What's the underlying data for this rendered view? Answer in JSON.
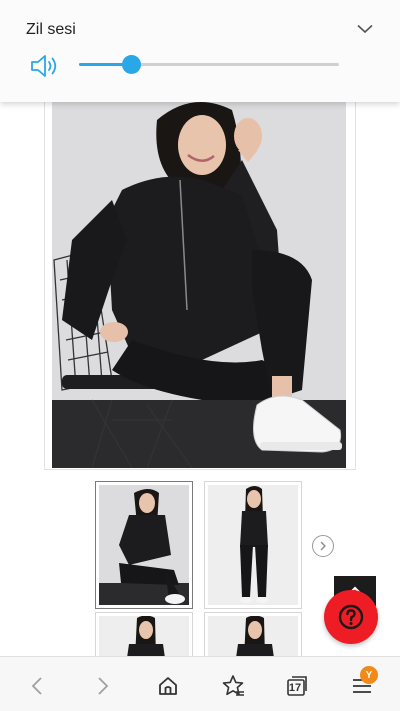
{
  "volume_panel": {
    "title": "Zil sesi",
    "level": 0.2,
    "accent": "#2aa7e6",
    "icons": {
      "speaker": "speaker-icon",
      "expand": "chevron-down-icon"
    }
  },
  "product": {
    "main_photo": "jumpsuit-seated-photo",
    "thumbnails": [
      {
        "name": "jumpsuit-seated-thumb",
        "selected": true
      },
      {
        "name": "jumpsuit-standing-thumb",
        "selected": false
      },
      {
        "name": "jumpsuit-front-thumb",
        "selected": false
      },
      {
        "name": "jumpsuit-front-alt-thumb",
        "selected": false
      }
    ],
    "next_icon": "chevron-right-icon"
  },
  "floating": {
    "scroll_top_icon": "chevron-up-icon",
    "help_icon": "question-mark-icon",
    "help_color": "#ee1c24"
  },
  "browser_bar": {
    "tabs_count": "17",
    "menu_badge": "Y",
    "badge_color": "#f28a1a",
    "icons": [
      "back-icon",
      "forward-icon",
      "home-icon",
      "bookmark-star-icon",
      "tabs-icon",
      "menu-icon"
    ]
  }
}
